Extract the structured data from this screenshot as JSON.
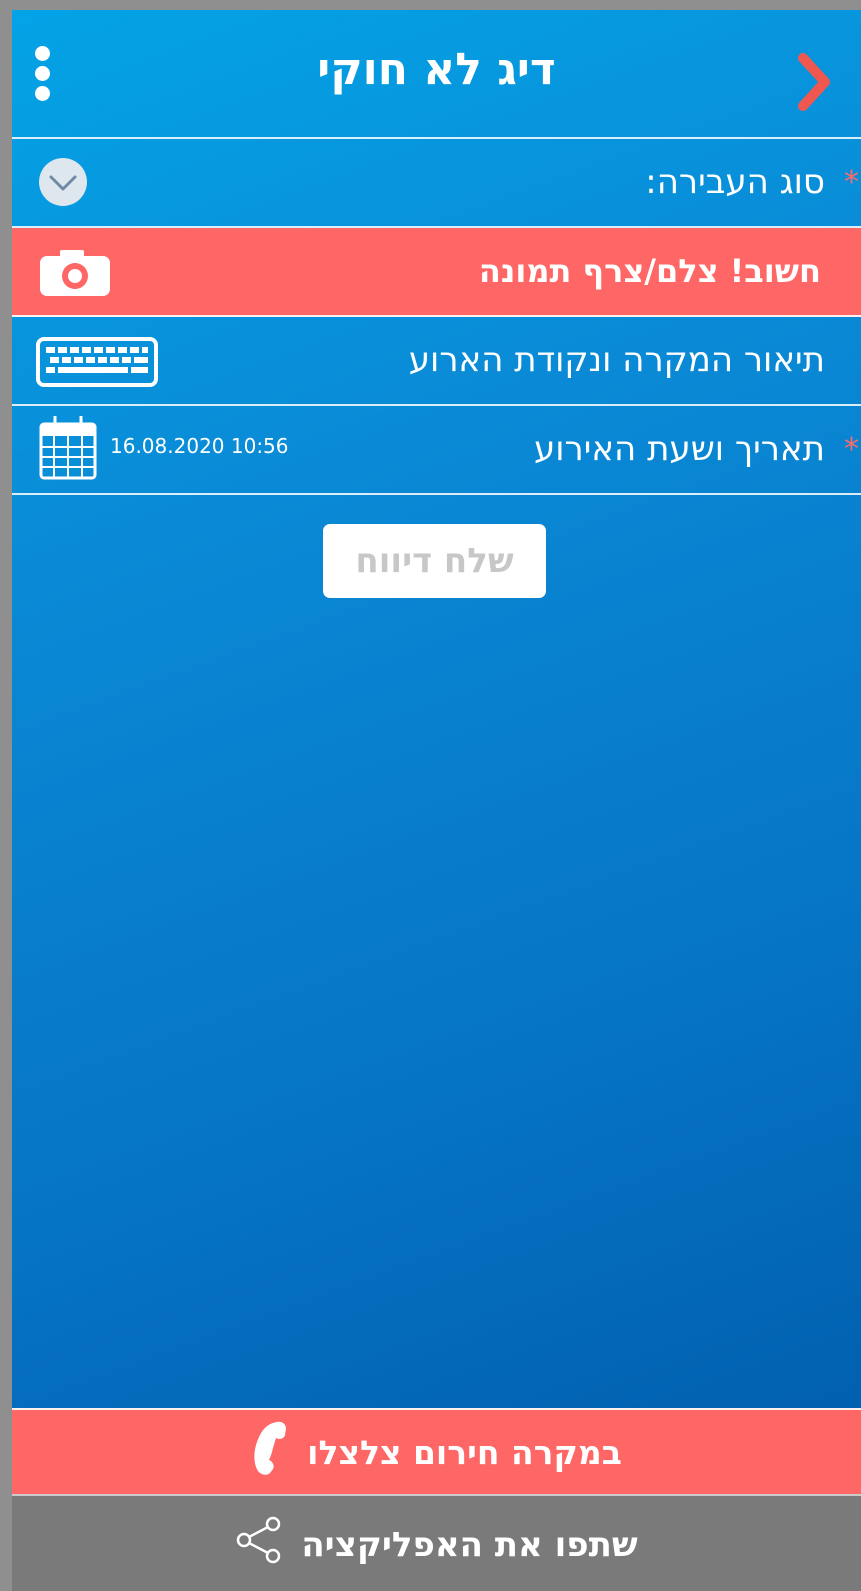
{
  "header": {
    "title": "דיג לא חוקי",
    "menu_icon": "vertical-dots-icon",
    "back_icon": "chevron-right-icon"
  },
  "form": {
    "violation_type_label": "סוג העבירה:",
    "photo_label": "חשוב! צלם/צרף תמונה",
    "description_label": "תיאור המקרה ונקודת הארוע",
    "datetime_label": "תאריך ושעת האירוע",
    "datetime_value": "16.08.2020 10:56",
    "required_marker": "*"
  },
  "actions": {
    "send_label": "שלח דיווח"
  },
  "footer": {
    "emergency_label": "במקרה חירום צלצלו",
    "share_label": "שתפו את האפליקציה"
  },
  "colors": {
    "accent_red": "#fe6766",
    "primary_blue": "#0a8ad6",
    "footer_gray": "#7a7a7a"
  }
}
